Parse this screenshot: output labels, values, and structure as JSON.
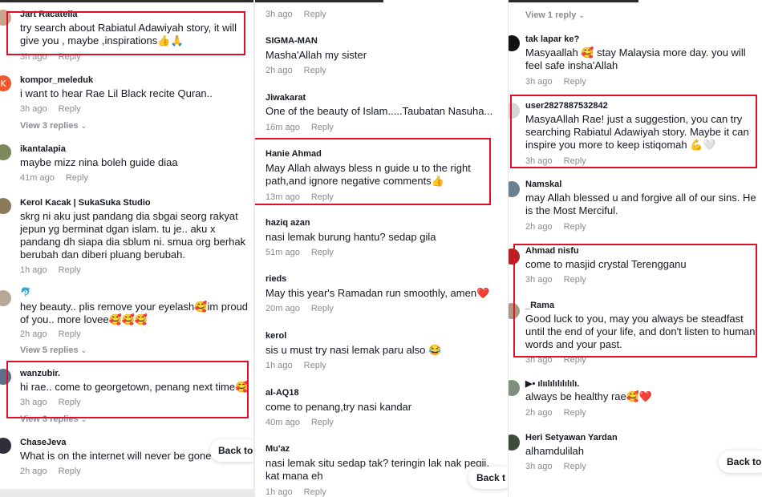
{
  "panel1": {
    "comments": [
      {
        "user": "Jart Racatella",
        "text": "try search about Rabiatul Adawiyah story, it will give you , maybe ,inspirations👍🙏",
        "time": "3h ago",
        "reply": "Reply"
      },
      {
        "user": "kompor_meleduk",
        "text": "i want to hear Rae Lil Black recite Quran..",
        "time": "3h ago",
        "reply": "Reply",
        "view_replies": "View 3 replies"
      },
      {
        "user": "ikantalapia",
        "text": "maybe mizz nina boleh guide diaa",
        "time": "41m ago",
        "reply": "Reply"
      },
      {
        "user": "Kerol Kacak | SukaSuka Studio",
        "text": "skrg ni aku just pandang dia sbgai seorg rakyat jepun yg berminat dgan islam. tu je.. aku x pandang dh siapa dia sblum ni. smua org berhak berubah dan diberi pluang berubah.",
        "time": "1h ago",
        "reply": "Reply"
      },
      {
        "user": "🐬",
        "text": "hey beauty.. plis remove your eyelash🥰im proud of you.. more lovee🥰🥰🥰",
        "time": "2h ago",
        "reply": "Reply",
        "view_replies": "View 5 replies"
      },
      {
        "user": "wanzubir.",
        "text": "hi rae.. come to georgetown, penang next time🥰",
        "time": "3h ago",
        "reply": "Reply",
        "view_replies": "View 3 replies"
      },
      {
        "user": "ChaseJeva",
        "text": "What is on the internet will never be gone",
        "time": "2h ago",
        "reply": "Reply"
      }
    ],
    "back_to": "Back to"
  },
  "panel2": {
    "top_meta": {
      "time": "3h ago",
      "reply": "Reply"
    },
    "comments": [
      {
        "user": "SIGMA-MAN",
        "text": "Masha'Allah my sister",
        "time": "2h ago",
        "reply": "Reply"
      },
      {
        "user": "Jiwakarat",
        "text": "One of the beauty of Islam.....Taubatan Nasuha...",
        "time": "16m ago",
        "reply": "Reply"
      },
      {
        "user": "Hanie Ahmad",
        "text": "May Allah always bless n guide u to the right path,and ignore negative comments👍",
        "time": "13m ago",
        "reply": "Reply"
      },
      {
        "user": "haziq azan",
        "text": "nasi lemak burung hantu? sedap gila",
        "time": "51m ago",
        "reply": "Reply"
      },
      {
        "user": "rieds",
        "text": "May this year's Ramadan run smoothly, amen❤️",
        "time": "20m ago",
        "reply": "Reply"
      },
      {
        "user": "kerol",
        "text": "sis u must try nasi lemak paru also 😂",
        "time": "1h ago",
        "reply": "Reply"
      },
      {
        "user": "al-AQ18",
        "text": "come to penang,try nasi kandar",
        "time": "40m ago",
        "reply": "Reply"
      },
      {
        "user": "Mu'az",
        "text": "nasi lemak situ sedap tak? teringin lak nak pegii. kat mana eh",
        "time": "1h ago",
        "reply": "Reply"
      }
    ],
    "back_to": "Back t"
  },
  "panel3": {
    "top_view": "View 1 reply",
    "comments": [
      {
        "user": "tak lapar ke?",
        "text": "Masyaallah 🥰 stay Malaysia more day. you will feel safe insha'Allah",
        "time": "3h ago",
        "reply": "Reply"
      },
      {
        "user": "user2827887532842",
        "text": "MasyaAllah Rae! just a suggestion, you can try searching Rabiatul Adawiyah story. Maybe it can inspire you more to keep istiqomah 💪🤍",
        "time": "3h ago",
        "reply": "Reply"
      },
      {
        "user": "Namskal",
        "text": "may Allah blessed u and forgive all of our sins. He is the Most Merciful.",
        "time": "2h ago",
        "reply": "Reply"
      },
      {
        "user": "Ahmad nisfu",
        "text": "come to masjid crystal Terengganu",
        "time": "3h ago",
        "reply": "Reply"
      },
      {
        "user": "_Rama",
        "text": "Good luck to you, may you always be steadfast until the end of your life, and don't listen to human words and your past.",
        "time": "3h ago",
        "reply": "Reply"
      },
      {
        "user": "▶• ılıılılılılılılı.",
        "text": "always be healthy rae🥰❤️",
        "time": "2h ago",
        "reply": "Reply"
      },
      {
        "user": "Heri Setyawan Yardan",
        "text": "alhamdulilah",
        "time": "3h ago",
        "reply": "Reply"
      }
    ],
    "back_to": "Back to"
  },
  "colors": {
    "highlight_box": "#e0102a",
    "meta_gray": "#8a8b91",
    "text": "#161823"
  }
}
